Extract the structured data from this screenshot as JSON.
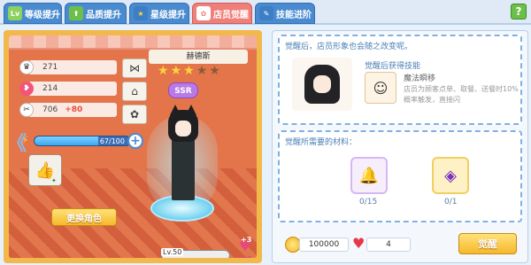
{
  "tabs": [
    {
      "label": "等级提升",
      "icon": "level-up-icon",
      "icon_text": "Lv"
    },
    {
      "label": "品质提升",
      "icon": "quality-up-icon",
      "icon_text": "⬆"
    },
    {
      "label": "星级提升",
      "icon": "star-icon",
      "icon_text": "★"
    },
    {
      "label": "店员觉醒",
      "icon": "awaken-icon",
      "icon_text": "✿"
    },
    {
      "label": "技能进阶",
      "icon": "skill-icon",
      "icon_text": "✎"
    }
  ],
  "active_tab": "店员觉醒",
  "help_label": "?",
  "character": {
    "name": "赫德斯",
    "rarity": "SSR",
    "stars_filled": 3,
    "stars_total": 5,
    "stats": [
      {
        "icon": "chef-hat-icon",
        "value": "271",
        "bonus": ""
      },
      {
        "icon": "bow-icon",
        "value": "214",
        "bonus": ""
      },
      {
        "icon": "scissors-icon",
        "value": "706",
        "bonus": "+80"
      }
    ],
    "exp_text": "67/100",
    "exp_fraction": 0.67,
    "level_label": "Lv.50",
    "favor_badge": "+3",
    "favor_label": "好感"
  },
  "change_button": "更换角色",
  "awaken_box": {
    "title": "觉醒后，店员形象也会随之改变呢。",
    "skill_title": "觉醒后获得技能",
    "skill_name": "魔法瞬移",
    "skill_desc": "店员为顾客点单、取餐、送餐时10%概率触发，直接闪"
  },
  "materials_box": {
    "title": "觉醒所需要的材料：",
    "items": [
      {
        "icon": "bell-icon",
        "count": "0/15",
        "bg": "#f6eefd"
      },
      {
        "icon": "gem-brooch-icon",
        "count": "0/1",
        "bg": "#fff1c6"
      }
    ]
  },
  "footer": {
    "coins": "100000",
    "hearts": "4",
    "awaken_button": "觉醒"
  }
}
